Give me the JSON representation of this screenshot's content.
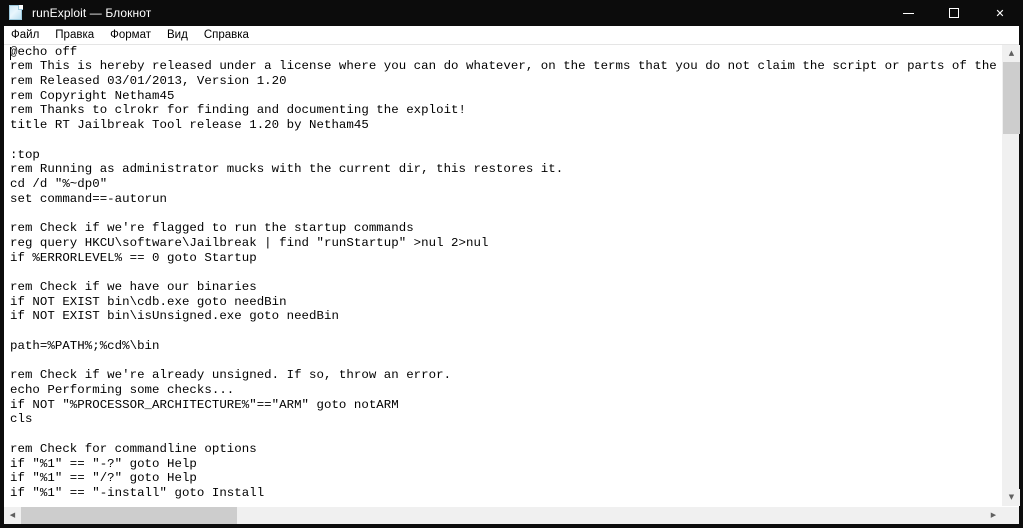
{
  "window": {
    "title": "runExploit — Блокнот",
    "icon": "notepad-icon",
    "controls": {
      "minimize_label": "—",
      "maximize_label": "□",
      "close_label": "✕"
    }
  },
  "menu": {
    "items": [
      {
        "label": "Файл"
      },
      {
        "label": "Правка"
      },
      {
        "label": "Формат"
      },
      {
        "label": "Вид"
      },
      {
        "label": "Справка"
      }
    ]
  },
  "editor": {
    "lines": [
      "@echo off",
      "rem This is hereby released under a license where you can do whatever, on the terms that you do not claim the script or parts of the script as your own",
      "rem Released 03/01/2013, Version 1.20",
      "rem Copyright Netham45",
      "rem Thanks to clrokr for finding and documenting the exploit!",
      "title RT Jailbreak Tool release 1.20 by Netham45",
      "",
      ":top",
      "rem Running as administrator mucks with the current dir, this restores it.",
      "cd /d \"%~dp0\"",
      "set command==-autorun",
      "",
      "rem Check if we're flagged to run the startup commands",
      "reg query HKCU\\software\\Jailbreak | find \"runStartup\" >nul 2>nul",
      "if %ERRORLEVEL% == 0 goto Startup",
      "",
      "rem Check if we have our binaries",
      "if NOT EXIST bin\\cdb.exe goto needBin",
      "if NOT EXIST bin\\isUnsigned.exe goto needBin",
      "",
      "path=%PATH%;%cd%\\bin",
      "",
      "rem Check if we're already unsigned. If so, throw an error.",
      "echo Performing some checks...",
      "if NOT \"%PROCESSOR_ARCHITECTURE%\"==\"ARM\" goto notARM",
      "cls",
      "",
      "rem Check for commandline options",
      "if \"%1\" == \"-?\" goto Help",
      "if \"%1\" == \"/?\" goto Help",
      "if \"%1\" == \"-install\" goto Install"
    ]
  },
  "scrollbars": {
    "vertical": {
      "up_arrow": "▲",
      "down_arrow": "▼"
    },
    "horizontal": {
      "left_arrow": "◀",
      "right_arrow": "▶"
    }
  },
  "colors": {
    "titlebar": "#0c0c0c",
    "titlebar_text": "#ffffff",
    "menubar": "#ffffff",
    "editor_background": "#ffffff",
    "editor_text": "#000000",
    "scrollbar_track": "#f0f0f0",
    "scrollbar_thumb": "#cdcdcd"
  }
}
